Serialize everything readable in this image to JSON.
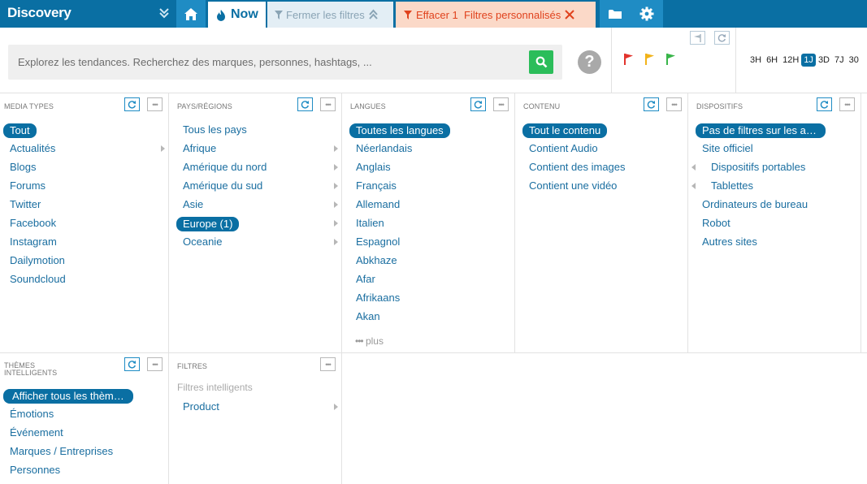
{
  "topbar": {
    "brand": "Discovery",
    "now_label": "Now",
    "close_filters_label": "Fermer les filtres",
    "clear_filters_label": "Effacer 1  Filtres personnalisés"
  },
  "search": {
    "placeholder": "Explorez les tendances. Recherchez des marques, personnes, hashtags, ..."
  },
  "help_label": "?",
  "time_range": [
    "3H",
    "6H",
    "12H",
    "1J",
    "3D",
    "7J",
    "30"
  ],
  "time_range_active": "1J",
  "panels": {
    "media_types": {
      "title": "MEDIA TYPES",
      "items": [
        "Tout",
        "Actualités",
        "Blogs",
        "Forums",
        "Twitter",
        "Facebook",
        "Instagram",
        "Dailymotion",
        "Soundcloud"
      ]
    },
    "regions": {
      "title": "PAYS/RÉGIONS",
      "items": [
        "Tous les pays",
        "Afrique",
        "Amérique du nord",
        "Amérique du sud",
        "Asie",
        "Europe (1)",
        "Oceanie"
      ]
    },
    "languages": {
      "title": "LANGUES",
      "items": [
        "Toutes les langues",
        "Néerlandais",
        "Anglais",
        "Français",
        "Allemand",
        "Italien",
        "Espagnol",
        "Abkhaze",
        "Afar",
        "Afrikaans",
        "Akan"
      ],
      "more_label": "plus"
    },
    "content": {
      "title": "CONTENU",
      "items": [
        "Tout le contenu",
        "Contient Audio",
        "Contient des images",
        "Contient une vidéo"
      ]
    },
    "devices": {
      "title": "DISPOSITIFS",
      "items": [
        "Pas de filtres sur les appar...",
        "Site officiel",
        "Dispositifs portables",
        "Tablettes",
        "Ordinateurs de bureau",
        "Robot",
        "Autres sites"
      ]
    },
    "themes": {
      "title_line1": "THÈMES",
      "title_line2": "INTELLIGENTS",
      "items": [
        "Afficher tous les thèmes i...",
        "Émotions",
        "Événement",
        "Marques / Entreprises",
        "Personnes"
      ]
    },
    "filters": {
      "title": "FILTRES",
      "subtitle": "Filtres intelligents",
      "items": [
        "Product"
      ]
    }
  },
  "colors": {
    "primary": "#0a6fa3",
    "accent_light": "#1f8cc4",
    "search_green": "#2bbd5a",
    "clear_red": "#e0421d",
    "flag_red": "#e2342d",
    "flag_yellow": "#f2b319",
    "flag_green": "#39b54a"
  }
}
